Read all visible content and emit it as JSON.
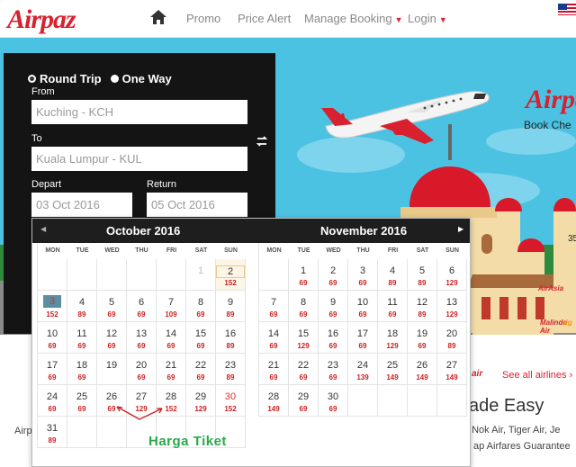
{
  "nav": {
    "logo": "Airpaz",
    "home_icon": "home-icon",
    "links": [
      "Promo",
      "Price Alert",
      "Manage Booking",
      "Login"
    ]
  },
  "search": {
    "trip_types": [
      "Round Trip",
      "One Way"
    ],
    "from_label": "From",
    "from_value": "Kuching - KCH",
    "to_label": "To",
    "to_value": "Kuala Lumpur - KUL",
    "depart_label": "Depart",
    "depart_value": "03 Oct 2016",
    "return_label": "Return",
    "return_value": "05 Oct 2016",
    "swap_icon": "swap-icon"
  },
  "hero": {
    "brand": "Airpaz",
    "tagline": "Book Che",
    "number": "35",
    "partners": [
      "AirAsia",
      "Malindo Air",
      "tig"
    ]
  },
  "calendar": {
    "prev_icon": "prev-month-icon",
    "next_icon": "next-month-icon",
    "weekdays": [
      "MON",
      "TUE",
      "WED",
      "THU",
      "FRI",
      "SAT",
      "SUN"
    ],
    "months": [
      {
        "title": "October 2016",
        "weeks": [
          [
            {
              "d": ""
            },
            {
              "d": ""
            },
            {
              "d": ""
            },
            {
              "d": ""
            },
            {
              "d": ""
            },
            {
              "d": "1",
              "p": "",
              "state": "disabled"
            },
            {
              "d": "2",
              "p": "152",
              "state": "today"
            }
          ],
          [
            {
              "d": "3",
              "p": "152",
              "state": "selected"
            },
            {
              "d": "4",
              "p": "89"
            },
            {
              "d": "5",
              "p": "69"
            },
            {
              "d": "6",
              "p": "69"
            },
            {
              "d": "7",
              "p": "109"
            },
            {
              "d": "8",
              "p": "69"
            },
            {
              "d": "9",
              "p": "89"
            }
          ],
          [
            {
              "d": "10",
              "p": "69"
            },
            {
              "d": "11",
              "p": "69"
            },
            {
              "d": "12",
              "p": "69"
            },
            {
              "d": "13",
              "p": "69"
            },
            {
              "d": "14",
              "p": "69"
            },
            {
              "d": "15",
              "p": "69"
            },
            {
              "d": "16",
              "p": "89"
            }
          ],
          [
            {
              "d": "17",
              "p": "69"
            },
            {
              "d": "18",
              "p": "69"
            },
            {
              "d": "19",
              "p": ""
            },
            {
              "d": "20",
              "p": "69"
            },
            {
              "d": "21",
              "p": "69"
            },
            {
              "d": "22",
              "p": "69"
            },
            {
              "d": "23",
              "p": "89"
            }
          ],
          [
            {
              "d": "24",
              "p": "69"
            },
            {
              "d": "25",
              "p": "69"
            },
            {
              "d": "26",
              "p": "69"
            },
            {
              "d": "27",
              "p": "129"
            },
            {
              "d": "28",
              "p": "152"
            },
            {
              "d": "29",
              "p": "129"
            },
            {
              "d": "30",
              "p": "152",
              "state": "red"
            }
          ],
          [
            {
              "d": "31",
              "p": "89"
            },
            {
              "d": ""
            },
            {
              "d": ""
            },
            {
              "d": ""
            },
            {
              "d": ""
            },
            {
              "d": ""
            },
            {
              "d": ""
            }
          ]
        ]
      },
      {
        "title": "November 2016",
        "weeks": [
          [
            {
              "d": ""
            },
            {
              "d": "1",
              "p": "69"
            },
            {
              "d": "2",
              "p": "69"
            },
            {
              "d": "3",
              "p": "69"
            },
            {
              "d": "4",
              "p": "89"
            },
            {
              "d": "5",
              "p": "89"
            },
            {
              "d": "6",
              "p": "129"
            }
          ],
          [
            {
              "d": "7",
              "p": "69"
            },
            {
              "d": "8",
              "p": "69"
            },
            {
              "d": "9",
              "p": "69"
            },
            {
              "d": "10",
              "p": "69"
            },
            {
              "d": "11",
              "p": "69"
            },
            {
              "d": "12",
              "p": "89"
            },
            {
              "d": "13",
              "p": "129"
            }
          ],
          [
            {
              "d": "14",
              "p": "69"
            },
            {
              "d": "15",
              "p": "129"
            },
            {
              "d": "16",
              "p": "69"
            },
            {
              "d": "17",
              "p": "69"
            },
            {
              "d": "18",
              "p": "129"
            },
            {
              "d": "19",
              "p": "69"
            },
            {
              "d": "20",
              "p": "89"
            }
          ],
          [
            {
              "d": "21",
              "p": "69"
            },
            {
              "d": "22",
              "p": "69"
            },
            {
              "d": "23",
              "p": "69"
            },
            {
              "d": "24",
              "p": "139"
            },
            {
              "d": "25",
              "p": "149"
            },
            {
              "d": "26",
              "p": "149"
            },
            {
              "d": "27",
              "p": "149"
            }
          ],
          [
            {
              "d": "28",
              "p": "149"
            },
            {
              "d": "29",
              "p": "69"
            },
            {
              "d": "30",
              "p": "69"
            },
            {
              "d": ""
            },
            {
              "d": ""
            },
            {
              "d": ""
            },
            {
              "d": ""
            }
          ]
        ]
      }
    ]
  },
  "annotation": {
    "label": "Harga Tiket"
  },
  "below": {
    "airline_logo": "air",
    "see_all": "See all airlines ›",
    "heading": "ade Easy",
    "airlines_line": ", Nok Air, Tiger Air, Je",
    "airfares_line": "ap Airfares Guarantee",
    "left_text": "Airp"
  },
  "colors": {
    "brand_red": "#d9202e",
    "price_red": "#cc2020",
    "hero_sky": "#4cc2e2",
    "panel_black": "#141414",
    "annotation_green": "#2aa84a"
  }
}
